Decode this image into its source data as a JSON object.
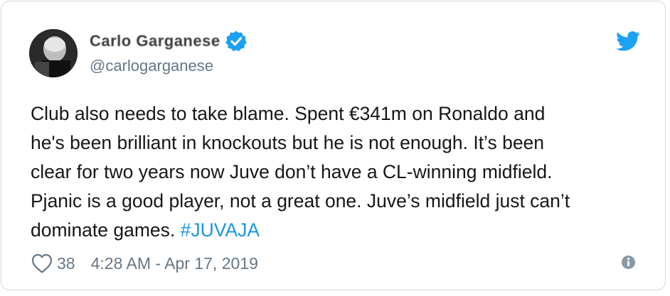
{
  "author": {
    "display_name": "Carlo Garganese",
    "handle": "@carlogarganese",
    "verified": true,
    "avatar_icon": "profile-photo"
  },
  "tweet": {
    "lines": [
      "Club also needs to take blame. Spent €341m on Ronaldo and",
      "he's been brilliant in knockouts but he is not enough. It’s been",
      "clear for two years now Juve don’t have a CL-winning midfield.",
      "Pjanic is a good player, not a great one. Juve’s midfield just can’t",
      "dominate games. "
    ],
    "hashtag": "#JUVAJA"
  },
  "footer": {
    "like_count": "38",
    "timestamp": "4:28 AM - Apr 17, 2019",
    "like_icon": "heart-icon",
    "info_icon": "info-icon"
  },
  "brand": {
    "logo_icon": "twitter-bird-icon",
    "accent_color": "#1da1f2",
    "link_color": "#1b95e0",
    "muted_color": "#657786"
  }
}
